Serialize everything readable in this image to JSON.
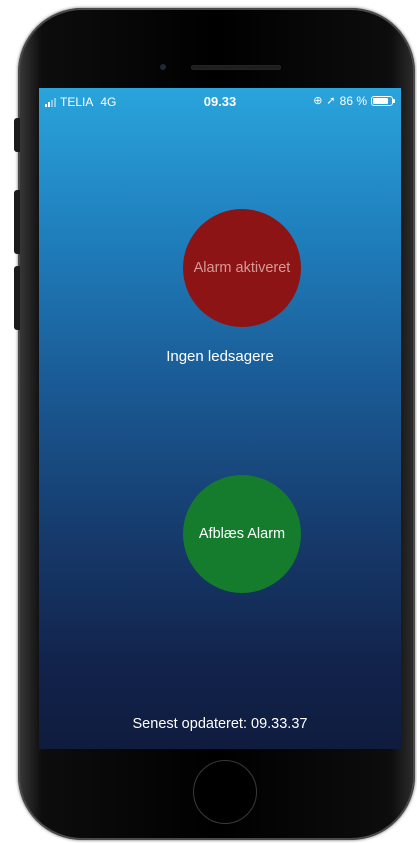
{
  "status_bar": {
    "carrier": "TELIA",
    "network": "4G",
    "time": "09.33",
    "battery_percent": "86 %",
    "battery_level": 0.86,
    "icons": [
      "signal-icon",
      "orientation-lock-icon",
      "location-icon",
      "battery-icon"
    ]
  },
  "alarm": {
    "status_label": "Alarm aktiveret",
    "status_color": "#8c1414",
    "companions_text": "Ingen ledsagere",
    "cancel_label": "Afblæs Alarm",
    "cancel_color": "#157c2d"
  },
  "footer": {
    "last_updated": "Senest opdateret: 09.33.37"
  }
}
